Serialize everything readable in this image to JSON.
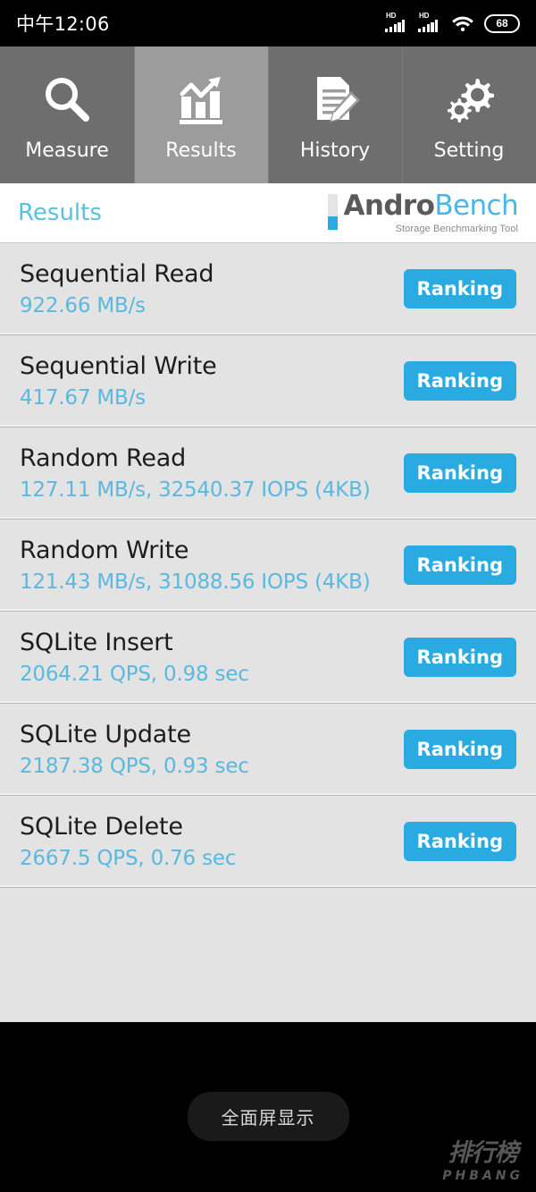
{
  "status_bar": {
    "time": "中午12:06",
    "signal_1_label": "HD",
    "signal_2_label": "HD",
    "wifi_icon": "wifi-icon",
    "battery_level": "68"
  },
  "tabs": [
    {
      "label": "Measure",
      "icon": "magnifier-icon",
      "active": false
    },
    {
      "label": "Results",
      "icon": "bar-chart-trend-icon",
      "active": true
    },
    {
      "label": "History",
      "icon": "document-pencil-icon",
      "active": false
    },
    {
      "label": "Setting",
      "icon": "gears-icon",
      "active": false
    }
  ],
  "header": {
    "title": "Results",
    "brand_primary": "Andro",
    "brand_secondary": "Bench",
    "brand_tagline": "Storage Benchmarking Tool"
  },
  "results": [
    {
      "title": "Sequential Read",
      "value": "922.66 MB/s",
      "button": "Ranking"
    },
    {
      "title": "Sequential Write",
      "value": "417.67 MB/s",
      "button": "Ranking"
    },
    {
      "title": "Random Read",
      "value": "127.11 MB/s, 32540.37 IOPS (4KB)",
      "button": "Ranking"
    },
    {
      "title": "Random Write",
      "value": "121.43 MB/s, 31088.56 IOPS (4KB)",
      "button": "Ranking"
    },
    {
      "title": "SQLite Insert",
      "value": "2064.21 QPS, 0.98 sec",
      "button": "Ranking"
    },
    {
      "title": "SQLite Update",
      "value": "2187.38 QPS, 0.93 sec",
      "button": "Ranking"
    },
    {
      "title": "SQLite Delete",
      "value": "2667.5 QPS, 0.76 sec",
      "button": "Ranking"
    }
  ],
  "footer": {
    "fullscreen_label": "全面屏显示",
    "watermark_cn": "排行榜",
    "watermark_en": "PHBANG"
  },
  "colors": {
    "accent_blue": "#29abe2",
    "value_blue": "#5bb8e0",
    "title_blue": "#5bc0de",
    "tab_inactive": "#6e6e6e",
    "tab_active": "#9c9c9c",
    "list_bg": "#e3e3e3"
  }
}
